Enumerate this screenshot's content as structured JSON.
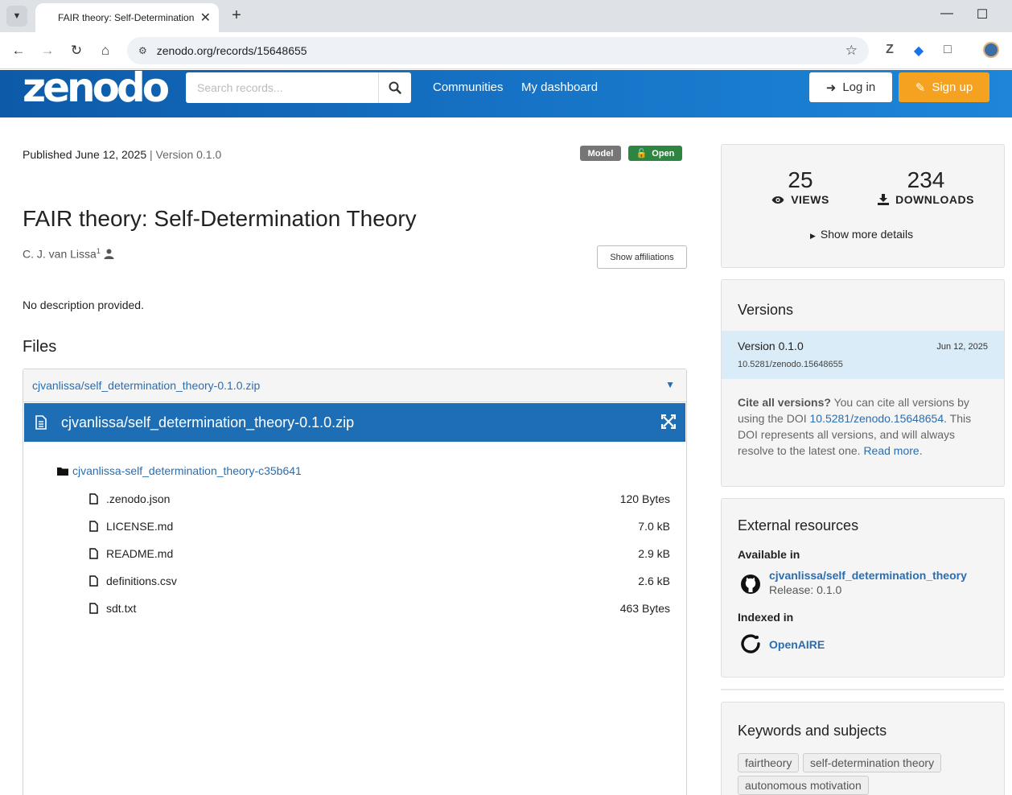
{
  "browser": {
    "tab_title": "FAIR theory: Self-Determination",
    "url": "zenodo.org/records/15648655"
  },
  "header": {
    "logo": "zenodo",
    "search_placeholder": "Search records...",
    "nav": [
      "Communities",
      "My dashboard"
    ],
    "login_label": "Log in",
    "signup_label": "Sign up"
  },
  "record": {
    "published": "Published June 12, 2025",
    "version_label": "Version 0.1.0",
    "badges": {
      "model": "Model",
      "open": "Open"
    },
    "title": "FAIR theory: Self-Determination Theory",
    "author": "C. J. van Lissa",
    "author_affil_sup": "1",
    "show_affiliations": "Show affiliations",
    "description": "No description provided."
  },
  "files": {
    "heading": "Files",
    "accordion_title": "cjvanlissa/self_determination_theory-0.1.0.zip",
    "zip_name": "cjvanlissa/self_determination_theory-0.1.0.zip",
    "folder": "cjvanlissa-self_determination_theory-c35b641",
    "items": [
      {
        "name": ".zenodo.json",
        "size": "120 Bytes"
      },
      {
        "name": "LICENSE.md",
        "size": "7.0 kB"
      },
      {
        "name": "README.md",
        "size": "2.9 kB"
      },
      {
        "name": "definitions.csv",
        "size": "2.6 kB"
      },
      {
        "name": "sdt.txt",
        "size": "463 Bytes"
      }
    ]
  },
  "stats": {
    "views": "25",
    "views_label": "VIEWS",
    "downloads": "234",
    "downloads_label": "DOWNLOADS",
    "more_details": "Show more details"
  },
  "versions": {
    "heading": "Versions",
    "current": {
      "name": "Version 0.1.0",
      "date": "Jun 12, 2025",
      "doi": "10.5281/zenodo.15648655"
    },
    "cite_bold": "Cite all versions?",
    "cite_text1": " You can cite all versions by using the DOI ",
    "cite_doi": "10.5281/zenodo.15648654",
    "cite_text2": ". This DOI represents all versions, and will always resolve to the latest one. ",
    "read_more": "Read more",
    "cite_end": "."
  },
  "external": {
    "heading": "External resources",
    "available_in": "Available in",
    "github_link": "cjvanlissa/self_determination_theory",
    "release": "Release: 0.1.0",
    "indexed_in": "Indexed in",
    "openaire": "OpenAIRE"
  },
  "keywords": {
    "heading": "Keywords and subjects",
    "tags": [
      "fairtheory",
      "self-determination theory",
      "autonomous motivation"
    ]
  },
  "colors": {
    "header_blue": "#1672c5",
    "signup_orange": "#f4a21f",
    "open_green": "#2e8540",
    "link_blue": "#2a6db0"
  }
}
